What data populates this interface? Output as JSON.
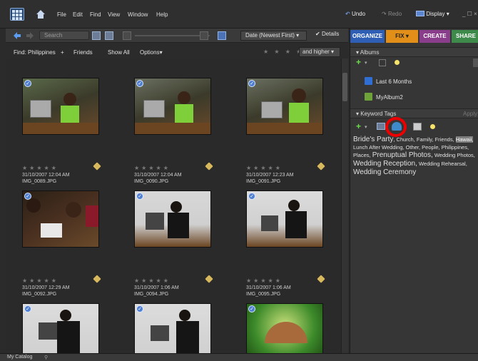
{
  "menubar": {
    "items": [
      "File",
      "Edit",
      "Find",
      "View",
      "Window",
      "Help"
    ],
    "undo_label": "Undo",
    "redo_label": "Redo",
    "display_label": "Display",
    "winctl": "_ ☐ ×"
  },
  "toolbar": {
    "search_placeholder": "Search",
    "sort_value": "Date (Newest First)",
    "details_label": "Details"
  },
  "findbar": {
    "find_label": "Find: Philippines",
    "plus": "+",
    "friends": "Friends",
    "show_all": "Show All",
    "options": "Options",
    "stars": "★ ★ ★ ★ ★",
    "higher": "and higher"
  },
  "thumbnails": [
    {
      "date": "31/10/2007 12:04 AM",
      "file": "IMG_0089.JPG"
    },
    {
      "date": "31/10/2007 12:04 AM",
      "file": "IMG_0090.JPG"
    },
    {
      "date": "31/10/2007 12:23 AM",
      "file": "IMG_0091.JPG"
    },
    {
      "date": "31/10/2007 12:29 AM",
      "file": "IMG_0092.JPG"
    },
    {
      "date": "31/10/2007 1:06 AM",
      "file": "IMG_0094.JPG"
    },
    {
      "date": "31/10/2007 1:06 AM",
      "file": "IMG_0095.JPG"
    }
  ],
  "tabs": {
    "organize": "ORGANIZE",
    "fix": "FIX",
    "create": "CREATE",
    "share": "SHARE"
  },
  "albums": {
    "header": "Albums",
    "items": [
      {
        "label": "Last 6 Months",
        "color": "#2f6fd3"
      },
      {
        "label": "MyAlbum2",
        "color": "#6ea33a"
      }
    ]
  },
  "keywords": {
    "header": "Keyword Tags",
    "apply": "Apply",
    "t1": "Bride's Party",
    "t2": ", Church, Family, Friends,",
    "t3": "Hawaii,",
    "t4": "Lunch After Wedding, Other, People, Philippines,",
    "t5": "Places,",
    "t6": "Prenuptual Photos,",
    "t7": "Wedding Photos,",
    "t8": "Wedding Reception,",
    "t9": "Wedding Rehearsal,",
    "t10": "Wedding Ceremony"
  },
  "status": {
    "catalog": "My Catalog"
  }
}
